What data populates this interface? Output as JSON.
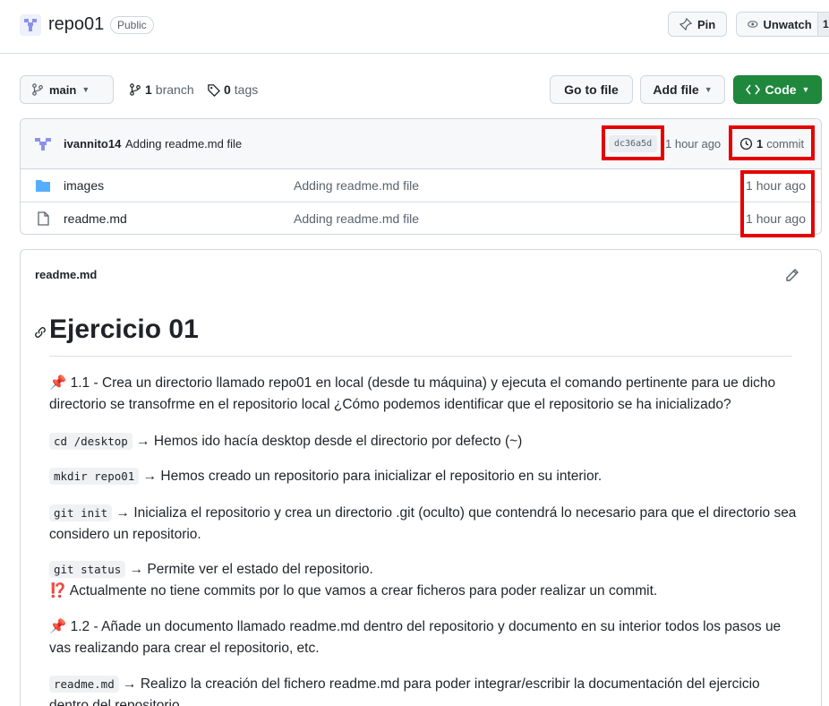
{
  "repo": {
    "name": "repo01",
    "visibility": "Public"
  },
  "header": {
    "pin_label": "Pin",
    "watch_label": "Unwatch",
    "watch_count": "1"
  },
  "toolbar": {
    "branch": "main",
    "branch_count": "1",
    "branch_label": "branch",
    "tag_count": "0",
    "tag_label": "tags",
    "goto_file": "Go to file",
    "add_file": "Add file",
    "code": "Code"
  },
  "commit": {
    "author": "ivannito14",
    "message": "Adding readme.md file",
    "sha": "dc36a5d",
    "time": "1 hour ago",
    "count": "1",
    "count_label": "commit"
  },
  "files": [
    {
      "name": "images",
      "type": "folder",
      "message": "Adding readme.md file",
      "time": "1 hour ago"
    },
    {
      "name": "readme.md",
      "type": "file",
      "message": "Adding readme.md file",
      "time": "1 hour ago"
    }
  ],
  "readme": {
    "filename": "readme.md",
    "title": "Ejercicio 01",
    "p1": "1.1 - Crea un directorio llamado repo01 en local (desde tu máquina) y ejecuta el comando pertinente para ue dicho directorio se transofrme en el repositorio local ¿Cómo podemos identificar que el repositorio se ha inicializado?",
    "c1": "cd /desktop",
    "t1": "→ Hemos ido hacía desktop desde el directorio por defecto (~)",
    "c2": "mkdir repo01",
    "t2": "→ Hemos creado un repositorio para inicializar el repositorio en su interior.",
    "c3": "git init",
    "t3": "→ Inicializa el repositorio y crea un directorio .git (oculto) que contendrá lo necesario para que el directorio sea considero un repositorio.",
    "c4": "git status",
    "t4": "→ Permite ver el estado del repositorio.",
    "warn": "Actualmente no tiene commits por lo que vamos a crear ficheros para poder realizar un commit.",
    "p2": "1.2 - Añade un documento llamado readme.md dentro del repositorio y documento en su interior todos los pasos ue vas realizando para crear el repositorio, etc.",
    "c5": "readme.md",
    "t5": "→ Realizo la creación del fichero readme.md para poder integrar/escribir la documentación del ejercicio dentro del repositorio."
  },
  "colors": {
    "accent_green": "#1f883d",
    "highlight_red": "#e60000",
    "folder_blue": "#54aeff"
  },
  "icons": [
    "repo-avatar-icon",
    "pin-icon",
    "eye-icon",
    "branch-icon",
    "tag-icon",
    "code-icon",
    "history-icon",
    "folder-icon",
    "file-icon",
    "pencil-icon",
    "link-icon",
    "pushpin-icon",
    "warning-icon"
  ]
}
